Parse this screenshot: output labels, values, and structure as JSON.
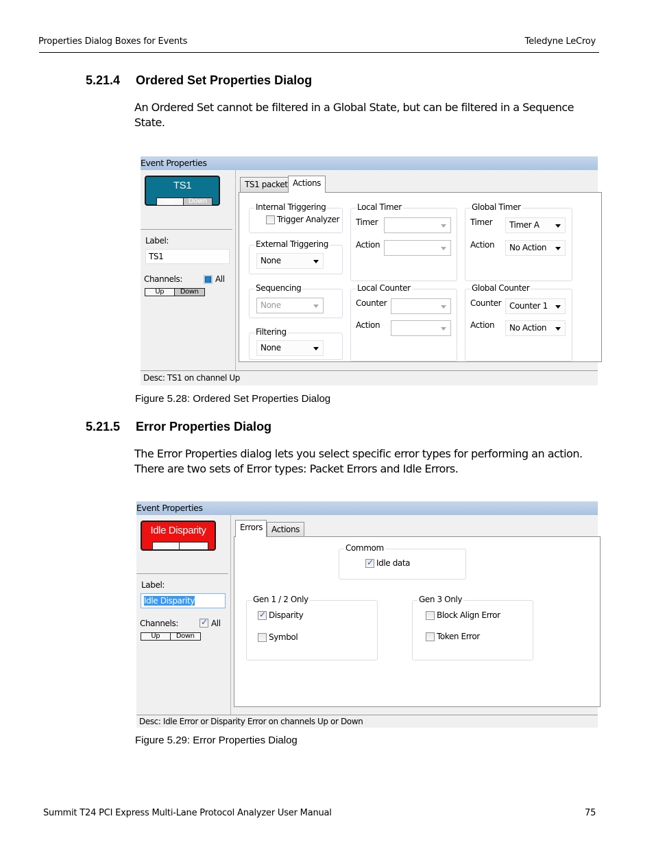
{
  "page": {
    "header_left": "Properties Dialog Boxes for Events",
    "header_right": "Teledyne LeCroy",
    "footer_left": "Summit T24 PCI Express Multi-Lane Protocol Analyzer User Manual",
    "footer_right": "75"
  },
  "section1": {
    "number": "5.21.4",
    "title": "Ordered Set Properties Dialog",
    "body_line1": "An Ordered Set cannot be filtered in a Global State, but can be filtered in a Sequence",
    "body_line2": "State.",
    "caption": "Figure 5.28:  Ordered Set Properties Dialog"
  },
  "dialog1": {
    "title": "Event Properties",
    "event_name": "TS1",
    "event_color": "#0b7390",
    "up": "Up",
    "down": "Down",
    "label_caption": "Label:",
    "label_value": "TS1",
    "channels_caption": "Channels:",
    "all_label": "All",
    "tabs": [
      "TS1 packet",
      "Actions"
    ],
    "active_tab": "Actions",
    "internal_triggering": {
      "title": "Internal Triggering",
      "checkbox": "Trigger Analyzer",
      "checked": false
    },
    "external_triggering": {
      "title": "External Triggering",
      "value": "None"
    },
    "sequencing": {
      "title": "Sequencing",
      "value": "None"
    },
    "filtering": {
      "title": "Filtering",
      "value": "None"
    },
    "local_timer": {
      "title": "Local Timer",
      "timer_label": "Timer",
      "timer_value": "",
      "action_label": "Action",
      "action_value": ""
    },
    "global_timer": {
      "title": "Global Timer",
      "timer_label": "Timer",
      "timer_value": "Timer A",
      "action_label": "Action",
      "action_value": "No Action"
    },
    "local_counter": {
      "title": "Local Counter",
      "counter_label": "Counter",
      "counter_value": "",
      "action_label": "Action",
      "action_value": ""
    },
    "global_counter": {
      "title": "Global Counter",
      "counter_label": "Counter",
      "counter_value": "Counter 1",
      "action_label": "Action",
      "action_value": "No Action"
    },
    "desc": "Desc: TS1 on channel Up"
  },
  "section2": {
    "number": "5.21.5",
    "title": "Error Properties Dialog",
    "body_line1": "The Error Properties dialog lets you select specific error types for performing an action.",
    "body_line2": "There are two sets of Error types: Packet Errors and Idle Errors.",
    "caption": "Figure 5.29:  Error Properties Dialog"
  },
  "dialog2": {
    "title": "Event Properties",
    "event_name": "Idle Disparity",
    "event_color": "#ee1111",
    "up": "Up",
    "down": "Down",
    "label_caption": "Label:",
    "label_value": "Idle Disparity",
    "channels_caption": "Channels:",
    "all_label": "All",
    "tabs": [
      "Errors",
      "Actions"
    ],
    "active_tab": "Errors",
    "common": {
      "title": "Commom",
      "items": [
        {
          "label": "Idle data",
          "checked": true
        }
      ]
    },
    "gen12": {
      "title": "Gen 1 / 2 Only",
      "items": [
        {
          "label": "Disparity",
          "checked": true
        },
        {
          "label": "Symbol",
          "checked": false
        }
      ]
    },
    "gen3": {
      "title": "Gen 3 Only",
      "items": [
        {
          "label": "Block Align Error",
          "checked": false
        },
        {
          "label": "Token Error",
          "checked": false
        }
      ]
    },
    "desc": "Desc: Idle Error or Disparity Error on channels Up or Down"
  }
}
